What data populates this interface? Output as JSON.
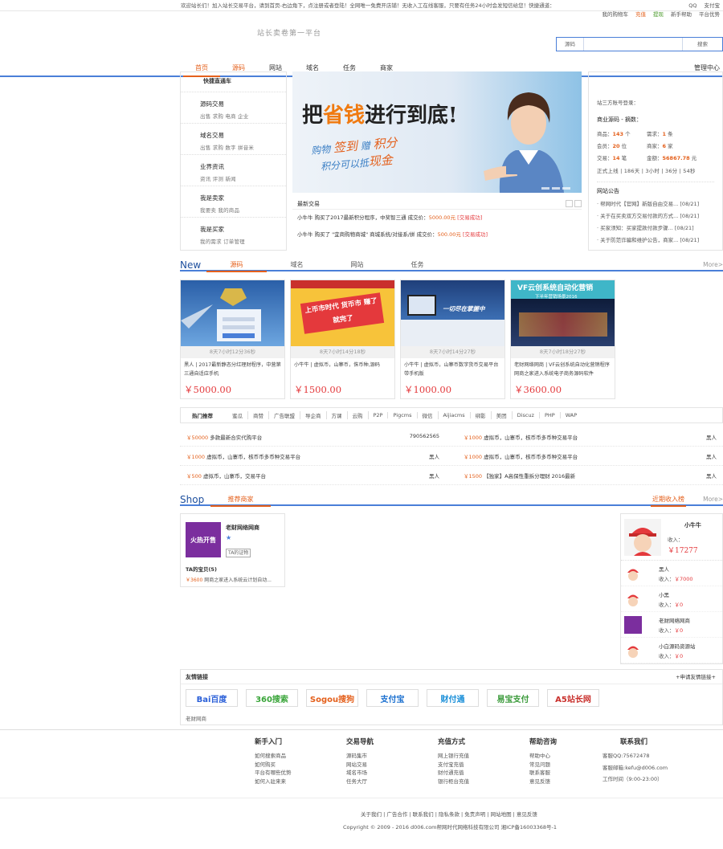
{
  "topbar": {
    "welcome": "欢迎站长们！加入站长交易平台，请到首页-右边角下，点注册或者登陆！全网唯一免费开店铺！无收入工在线客服，只要有任务24小时会发短信给您！快捷通道：",
    "links": [
      "QQ",
      "支付宝"
    ],
    "links2": [
      "我的购物车",
      "充值",
      "提现",
      "新手帮助",
      "平台优势"
    ]
  },
  "header": {
    "slogan": "站长卖卷第一平台",
    "search_type": "源码",
    "search_placeholder": "",
    "search_button": "搜索"
  },
  "nav": {
    "items": [
      "首页",
      "源码",
      "网站",
      "域名",
      "任务",
      "商家"
    ],
    "manage": "管理中心"
  },
  "categories": {
    "title": "快捷直通车",
    "items": [
      {
        "name": "源码交易",
        "subs": "出售 求购 电商 企业"
      },
      {
        "name": "域名交易",
        "subs": "出售 求购 数字 拼音米"
      },
      {
        "name": "业界资讯",
        "subs": "资讯 评测 新闻"
      },
      {
        "name": "我是卖家",
        "subs": "我要卖 我的商品"
      },
      {
        "name": "我是买家",
        "subs": "我的需求 订单管理"
      }
    ]
  },
  "banner": {
    "big_1": "把",
    "big_2": "省钱",
    "big_3": "进行到底!",
    "line1_a": "购物",
    "line1_b": "签到",
    "line1_c": "赠",
    "line1_d": "积分",
    "line2_a": "积分可以抵",
    "line2_b": "现金"
  },
  "deals": {
    "title": "最新交易",
    "items": [
      {
        "text": "小牛牛 购买了2017最新积分程序，中奖智三通 成交价：",
        "price": "5000.00元",
        "status": "[交易成功]"
      },
      {
        "text": "小牛牛 购买了 \"宜商购物商城\" 商城系统/对接系/拼 成交价：",
        "price": "500.00元",
        "status": "[交易成功]"
      }
    ]
  },
  "stats": {
    "caption": "站三方账号登录：",
    "subtitle": "商业源码 - 摘数：",
    "rows": [
      {
        "k": "商品：",
        "v": "143",
        "u": "个"
      },
      {
        "k": "需求：",
        "v": "1",
        "u": "条"
      },
      {
        "k": "会员：",
        "v": "20",
        "u": "位"
      },
      {
        "k": "商家：",
        "v": "6",
        "u": "家"
      },
      {
        "k": "交易：",
        "v": "14",
        "u": "笔"
      },
      {
        "k": "金额：",
        "v": "56867.78",
        "u": "元"
      }
    ],
    "runtime": "正式上线 | 186天 | 3小时 | 36分 | 54秒",
    "notice_title": "网站公告",
    "news": [
      "· 帮网时代【官网】新版自由交易... [08/21]",
      "· 关于在买卖双方交易付款的方式... [08/21]",
      "· 买家须知：买家提款付款步骤... [08/21]",
      "· 关于防范诈骗和维护公告，商家... [08/21]"
    ]
  },
  "new_section": {
    "title": "New",
    "tabs": [
      "源码",
      "域名",
      "网站",
      "任务"
    ],
    "more": "More>"
  },
  "cards": [
    {
      "time": "8天7小时12分36秒",
      "desc": "黑人 | 2017最新静态分红理财程序，中营第三通自适应手机",
      "price": "￥5000.00"
    },
    {
      "time": "8天7小时14分18秒",
      "desc": "小牛牛 | 虚拟币，山寨币，侏币种,源码",
      "price": "￥1500.00"
    },
    {
      "time": "8天7小时14分27秒",
      "desc": "小牛牛 | 虚拟币，山寨币数字货币交易平台带手机版",
      "price": "￥1000.00"
    },
    {
      "time": "8天7小时18分27秒",
      "desc": "老财网络网商 | VF云创系统自动化营销程序网商之家进入系统电子商务源码软件",
      "price": "￥3600.00"
    }
  ],
  "card_images": [
    {
      "caption": ""
    },
    {
      "caption": "上币市时代 货币市 赚了 就完了"
    },
    {
      "caption": "一切尽在掌握中"
    },
    {
      "caption": "VF云创系统自动化营销",
      "sub": "下半年营销场景2016"
    }
  ],
  "hot": {
    "label": "热门推荐",
    "keywords": [
      "蜜瓜",
      "商赞",
      "广告联盟",
      "导企商",
      "方课",
      "云购",
      "P2P",
      "Pigcms",
      "微信",
      "Aijiacms",
      "绑影",
      "美团",
      "Discuz",
      "PHP",
      "WAP"
    ]
  },
  "hot_list": [
    [
      {
        "price": "￥50000",
        "title": "多款最新合实代购平台",
        "who": "790562565"
      },
      {
        "price": "￥1000",
        "title": "虚拟币，山寨币，核币币多币种交易平台",
        "who": "黑人"
      }
    ],
    [
      {
        "price": "￥1000",
        "title": "虚拟币，山寨币，核币币多币种交易平台",
        "who": "黑人"
      },
      {
        "price": "￥1000",
        "title": "虚拟币，山寨币，核币币多币种交易平台",
        "who": "黑人"
      }
    ],
    [
      {
        "price": "￥500",
        "title": "虚拟币，山寨币，交易平台",
        "who": "黑人"
      },
      {
        "price": "￥1500",
        "title": "【独家】A高保性重拆分理财 2016最新",
        "who": "黑人"
      }
    ]
  ],
  "shop_section": {
    "title": "Shop",
    "tab": "推荐商家",
    "rank_tab": "近期收入榜",
    "more": "More>"
  },
  "shop": {
    "logo_text": "火热开售",
    "name": "老财网络网商",
    "tag": "TA的证物",
    "dz_title": "TA的宝贝(5)",
    "item_price": "￥3600",
    "item_title": "网商之家进入系统云计划自动..."
  },
  "rank": {
    "top": {
      "name": "小牛牛",
      "label": "收入：",
      "value": "￥17277"
    },
    "items": [
      {
        "name": "黑人",
        "label": "收入：",
        "value": "￥7000"
      },
      {
        "name": "小黑",
        "label": "收入：",
        "value": "￥0"
      },
      {
        "name": "老财网络网商",
        "label": "收入：",
        "value": "￥0"
      },
      {
        "name": "小白源码资源站",
        "label": "收入：",
        "value": "￥0"
      }
    ]
  },
  "friends": {
    "title": "友情链接",
    "apply": "+申请友情链接+",
    "logos": [
      "Bai百度",
      "360搜索",
      "Sogou搜狗",
      "支付宝",
      "财付通",
      "易宝支付",
      "A5站长网"
    ],
    "footer_text": "老财网商"
  },
  "footer": {
    "cols": [
      {
        "h": "新手入门",
        "links": [
          "如何搜索商品",
          "如何购买",
          "平台有哪些优势",
          "如何入驻来来"
        ]
      },
      {
        "h": "交易导航",
        "links": [
          "源码集市",
          "网站交易",
          "域名市场",
          "任务大厅"
        ]
      },
      {
        "h": "充值方式",
        "links": [
          "网上银行充值",
          "支付宝充值",
          "财付通充值",
          "银行柜台充值"
        ]
      },
      {
        "h": "帮助咨询",
        "links": [
          "帮助中心",
          "常见问题",
          "联系客服",
          "意见反馈"
        ]
      },
      {
        "h": "联系我们",
        "links": [
          "客服QQ:75672478",
          "客服邮箱:kefu@d006.com",
          "工作时间（9:00-23:00）"
        ]
      }
    ],
    "bottom_links": "关于我们 | 广告合作 | 联系我们 | 隐私条款 | 免责声明 | 网站地图 | 意见反馈",
    "copyright": "Copyright © 2009 - 2016 d006.com帮网时代网络科技有限公司 湘ICP备16003368号-1"
  },
  "colors": {
    "accent": "#e4601c",
    "brand": "#4a7fd8",
    "price": "#e4393c"
  }
}
